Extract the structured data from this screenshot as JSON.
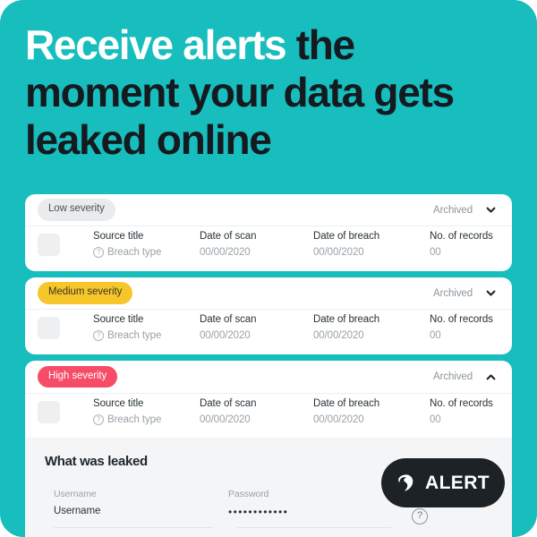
{
  "theme": {
    "background_teal": "#18bdbd",
    "headline_dark": "#141a1f",
    "headline_light": "#ffffff",
    "card_white": "#ffffff",
    "panel_gray": "#f4f5f6",
    "severity_low": "#e9ebec",
    "severity_medium": "#f7c62a",
    "severity_high": "#f64c68",
    "alert_pill": "#1d2226"
  },
  "headline": {
    "highlight": "Receive alerts",
    "rest": " the moment your data gets leaked online"
  },
  "alerts": [
    {
      "severity_label": "Low severity",
      "severity_level": "low",
      "status_label": "Archived",
      "chevron": "chevron-down-icon",
      "source_title": "Source title",
      "breach_type": "Breach type",
      "scan_title": "Date of scan",
      "scan_value": "00/00/2020",
      "breach_title": "Date of breach",
      "breach_value": "00/00/2020",
      "records_title": "No. of records",
      "records_value": "00"
    },
    {
      "severity_label": "Medium severity",
      "severity_level": "medium",
      "status_label": "Archived",
      "chevron": "chevron-down-icon",
      "source_title": "Source title",
      "breach_type": "Breach type",
      "scan_title": "Date of scan",
      "scan_value": "00/00/2020",
      "breach_title": "Date of breach",
      "breach_value": "00/00/2020",
      "records_title": "No. of records",
      "records_value": "00"
    },
    {
      "severity_label": "High severity",
      "severity_level": "high",
      "status_label": "Archived",
      "chevron": "chevron-up-icon",
      "source_title": "Source title",
      "breach_type": "Breach type",
      "scan_title": "Date of scan",
      "scan_value": "00/00/2020",
      "breach_title": "Date of breach",
      "breach_value": "00/00/2020",
      "records_title": "No. of records",
      "records_value": "00"
    }
  ],
  "leaked_panel": {
    "title": "What was leaked",
    "fields": [
      {
        "label": "Username",
        "value": "Username"
      },
      {
        "label": "Password",
        "value": "••••••••••••"
      }
    ],
    "help_icon": "question-circle-icon"
  },
  "alert_pill": {
    "logo_icon": "surfshark-logo-icon",
    "label": "ALERT"
  }
}
